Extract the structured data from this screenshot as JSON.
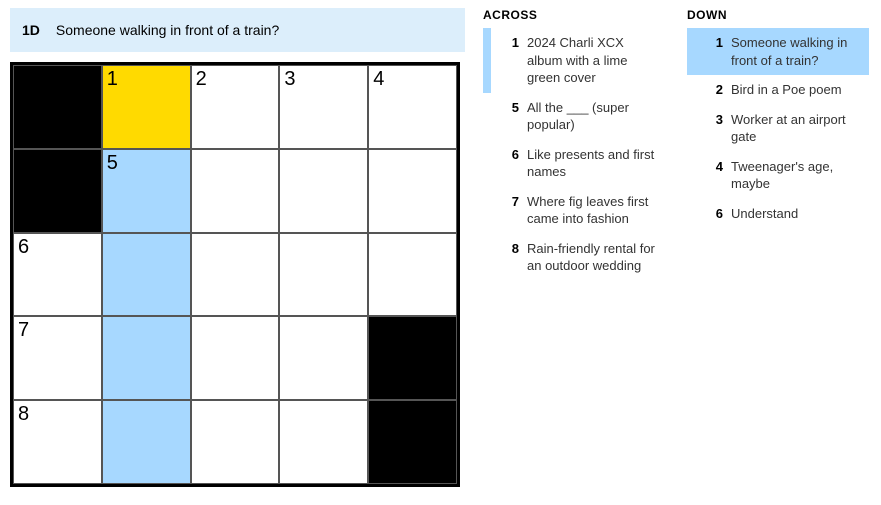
{
  "current_clue": {
    "label": "1D",
    "text": "Someone walking in front of a train?"
  },
  "grid": [
    [
      {
        "black": true
      },
      {
        "num": "1",
        "focus": true
      },
      {
        "num": "2"
      },
      {
        "num": "3"
      },
      {
        "num": "4"
      }
    ],
    [
      {
        "black": true
      },
      {
        "num": "5",
        "word": true
      },
      {},
      {},
      {}
    ],
    [
      {
        "num": "6"
      },
      {
        "word": true
      },
      {},
      {},
      {}
    ],
    [
      {
        "num": "7"
      },
      {
        "word": true
      },
      {},
      {},
      {
        "black": true
      }
    ],
    [
      {
        "num": "8"
      },
      {
        "word": true
      },
      {},
      {},
      {
        "black": true
      }
    ]
  ],
  "across": {
    "title": "ACROSS",
    "clues": [
      {
        "num": "1",
        "text": "2024 Charli XCX album with a lime green cover",
        "related": true
      },
      {
        "num": "5",
        "text": "All the ___ (super popular)"
      },
      {
        "num": "6",
        "text": "Like presents and first names"
      },
      {
        "num": "7",
        "text": "Where fig leaves first came into fashion"
      },
      {
        "num": "8",
        "text": "Rain-friendly rental for an outdoor wedding"
      }
    ]
  },
  "down": {
    "title": "DOWN",
    "clues": [
      {
        "num": "1",
        "text": "Someone walking in front of a train?",
        "current": true
      },
      {
        "num": "2",
        "text": "Bird in a Poe poem"
      },
      {
        "num": "3",
        "text": "Worker at an airport gate"
      },
      {
        "num": "4",
        "text": "Tweenager's age, maybe"
      },
      {
        "num": "6",
        "text": "Understand"
      }
    ]
  }
}
